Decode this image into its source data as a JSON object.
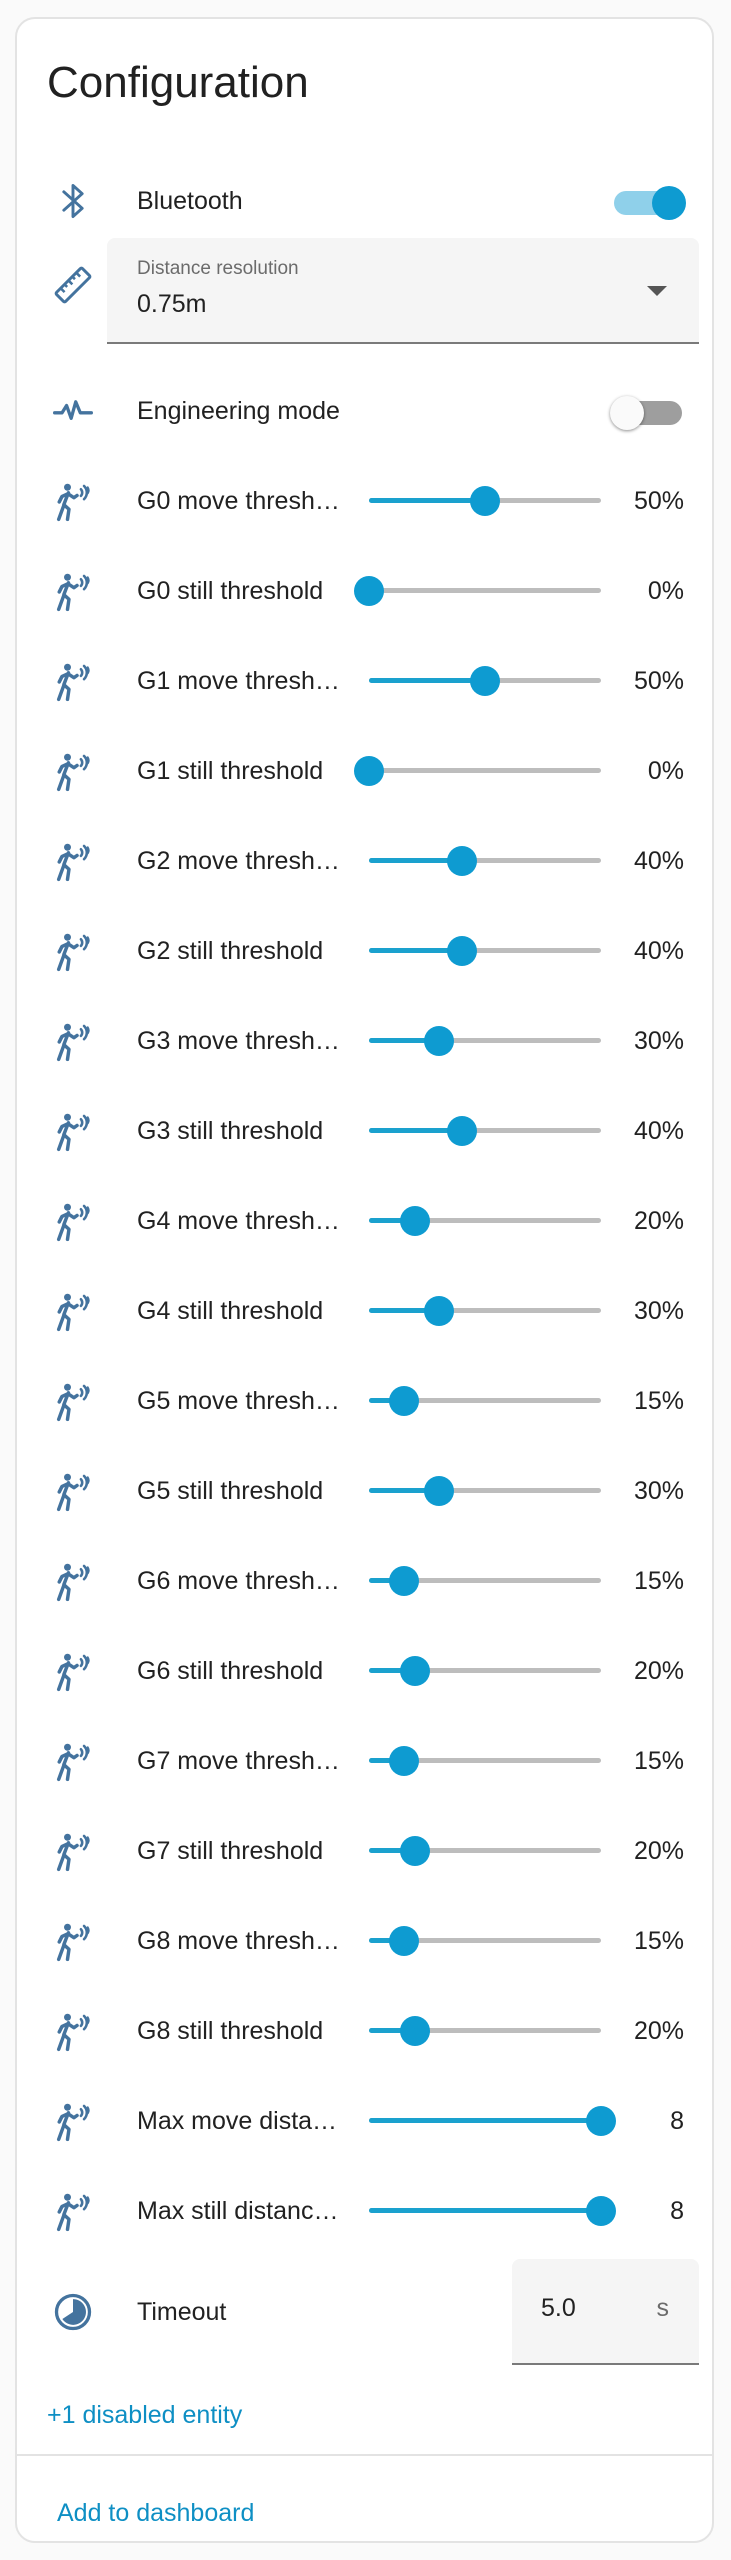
{
  "title": "Configuration",
  "accent_color": "#0e9bd1",
  "bluetooth": {
    "label": "Bluetooth",
    "icon": "bluetooth-icon",
    "state": "on"
  },
  "distance_resolution": {
    "label": "Distance resolution",
    "value": "0.75m",
    "icon": "ruler-icon"
  },
  "engineering_mode": {
    "label": "Engineering mode",
    "icon": "pulse-icon",
    "state": "off"
  },
  "sliders": [
    {
      "label": "G0 move thresh…",
      "value_text": "50%",
      "value": 50,
      "max": 100,
      "icon": "motion-sensor-icon"
    },
    {
      "label": "G0 still threshold",
      "value_text": "0%",
      "value": 0,
      "max": 100,
      "icon": "motion-sensor-icon"
    },
    {
      "label": "G1 move thresh…",
      "value_text": "50%",
      "value": 50,
      "max": 100,
      "icon": "motion-sensor-icon"
    },
    {
      "label": "G1 still threshold",
      "value_text": "0%",
      "value": 0,
      "max": 100,
      "icon": "motion-sensor-icon"
    },
    {
      "label": "G2 move thresh…",
      "value_text": "40%",
      "value": 40,
      "max": 100,
      "icon": "motion-sensor-icon"
    },
    {
      "label": "G2 still threshold",
      "value_text": "40%",
      "value": 40,
      "max": 100,
      "icon": "motion-sensor-icon"
    },
    {
      "label": "G3 move thresh…",
      "value_text": "30%",
      "value": 30,
      "max": 100,
      "icon": "motion-sensor-icon"
    },
    {
      "label": "G3 still threshold",
      "value_text": "40%",
      "value": 40,
      "max": 100,
      "icon": "motion-sensor-icon"
    },
    {
      "label": "G4 move thresh…",
      "value_text": "20%",
      "value": 20,
      "max": 100,
      "icon": "motion-sensor-icon"
    },
    {
      "label": "G4 still threshold",
      "value_text": "30%",
      "value": 30,
      "max": 100,
      "icon": "motion-sensor-icon"
    },
    {
      "label": "G5 move thresh…",
      "value_text": "15%",
      "value": 15,
      "max": 100,
      "icon": "motion-sensor-icon"
    },
    {
      "label": "G5 still threshold",
      "value_text": "30%",
      "value": 30,
      "max": 100,
      "icon": "motion-sensor-icon"
    },
    {
      "label": "G6 move thresh…",
      "value_text": "15%",
      "value": 15,
      "max": 100,
      "icon": "motion-sensor-icon"
    },
    {
      "label": "G6 still threshold",
      "value_text": "20%",
      "value": 20,
      "max": 100,
      "icon": "motion-sensor-icon"
    },
    {
      "label": "G7 move thresh…",
      "value_text": "15%",
      "value": 15,
      "max": 100,
      "icon": "motion-sensor-icon"
    },
    {
      "label": "G7 still threshold",
      "value_text": "20%",
      "value": 20,
      "max": 100,
      "icon": "motion-sensor-icon"
    },
    {
      "label": "G8 move thresh…",
      "value_text": "15%",
      "value": 15,
      "max": 100,
      "icon": "motion-sensor-icon"
    },
    {
      "label": "G8 still threshold",
      "value_text": "20%",
      "value": 20,
      "max": 100,
      "icon": "motion-sensor-icon"
    },
    {
      "label": "Max move dista…",
      "value_text": "8",
      "value": 8,
      "max": 8,
      "icon": "motion-sensor-icon"
    },
    {
      "label": "Max still distanc…",
      "value_text": "8",
      "value": 8,
      "max": 8,
      "icon": "motion-sensor-icon"
    }
  ],
  "timeout": {
    "label": "Timeout",
    "value": "5.0",
    "unit": "s",
    "icon": "timer-icon"
  },
  "disabled_link": "+1 disabled entity",
  "add_to_dashboard": "Add to dashboard"
}
